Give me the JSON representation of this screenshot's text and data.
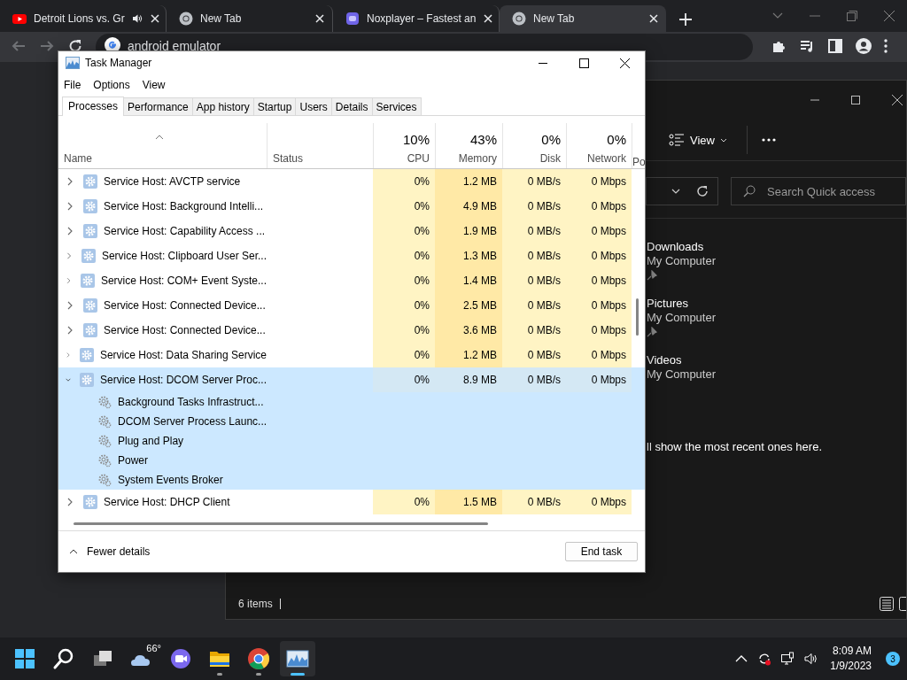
{
  "browser": {
    "tabs": [
      {
        "kind": "youtube",
        "label": "Detroit Lions vs. Gr",
        "audio": true,
        "selected": false
      },
      {
        "kind": "chrome",
        "label": "New Tab",
        "audio": false,
        "selected": false
      },
      {
        "kind": "nox",
        "label": "Noxplayer – Fastest an",
        "audio": false,
        "selected": false
      },
      {
        "kind": "chrome",
        "label": "New Tab",
        "audio": false,
        "selected": true
      }
    ],
    "address": "android emulator"
  },
  "explorer": {
    "view_label": "View",
    "search": {
      "placeholder": "Search Quick access"
    },
    "items": [
      {
        "name": "Downloads",
        "location": "My Computer",
        "pinned": true
      },
      {
        "name": "Pictures",
        "location": "My Computer",
        "pinned": true
      },
      {
        "name": "Videos",
        "location": "My Computer",
        "pinned": false
      }
    ],
    "hint": "ll show the most recent ones here.",
    "status": "6 items"
  },
  "task_manager": {
    "title": "Task Manager",
    "menu": [
      "File",
      "Options",
      "View"
    ],
    "tabs": [
      {
        "label": "Processes",
        "selected": true
      },
      {
        "label": "Performance",
        "selected": false
      },
      {
        "label": "App history",
        "selected": false
      },
      {
        "label": "Startup",
        "selected": false
      },
      {
        "label": "Users",
        "selected": false
      },
      {
        "label": "Details",
        "selected": false
      },
      {
        "label": "Services",
        "selected": false
      }
    ],
    "columns": [
      {
        "name": "Name",
        "sorted": true
      },
      {
        "name": "Status",
        "sorted": false
      },
      {
        "name": "CPU",
        "total": "10%",
        "sorted": false
      },
      {
        "name": "Memory",
        "total": "43%",
        "sorted": false
      },
      {
        "name": "Disk",
        "total": "0%",
        "sorted": false
      },
      {
        "name": "Network",
        "total": "0%",
        "sorted": false
      },
      {
        "name": "Po",
        "sorted": false
      }
    ],
    "rows": [
      {
        "name": "Service Host: AVCTP service",
        "cpu": "0%",
        "memory": "1.2 MB",
        "disk": "0 MB/s",
        "network": "0 Mbps",
        "expanded": false,
        "selected": false
      },
      {
        "name": "Service Host: Background Intelli...",
        "cpu": "0%",
        "memory": "4.9 MB",
        "disk": "0 MB/s",
        "network": "0 Mbps",
        "expanded": false,
        "selected": false
      },
      {
        "name": "Service Host: Capability Access ...",
        "cpu": "0%",
        "memory": "1.9 MB",
        "disk": "0 MB/s",
        "network": "0 Mbps",
        "expanded": false,
        "selected": false
      },
      {
        "name": "Service Host: Clipboard User Ser...",
        "cpu": "0%",
        "memory": "1.3 MB",
        "disk": "0 MB/s",
        "network": "0 Mbps",
        "expanded": false,
        "selected": false
      },
      {
        "name": "Service Host: COM+ Event Syste...",
        "cpu": "0%",
        "memory": "1.4 MB",
        "disk": "0 MB/s",
        "network": "0 Mbps",
        "expanded": false,
        "selected": false
      },
      {
        "name": "Service Host: Connected Device...",
        "cpu": "0%",
        "memory": "2.5 MB",
        "disk": "0 MB/s",
        "network": "0 Mbps",
        "expanded": false,
        "selected": false
      },
      {
        "name": "Service Host: Connected Device...",
        "cpu": "0%",
        "memory": "3.6 MB",
        "disk": "0 MB/s",
        "network": "0 Mbps",
        "expanded": false,
        "selected": false
      },
      {
        "name": "Service Host: Data Sharing Service",
        "cpu": "0%",
        "memory": "1.2 MB",
        "disk": "0 MB/s",
        "network": "0 Mbps",
        "expanded": false,
        "selected": false
      },
      {
        "name": "Service Host: DCOM Server Proc...",
        "cpu": "0%",
        "memory": "8.9 MB",
        "disk": "0 MB/s",
        "network": "0 Mbps",
        "expanded": true,
        "selected": true,
        "children": [
          {
            "name": "Background Tasks Infrastruct..."
          },
          {
            "name": "DCOM Server Process Launc..."
          },
          {
            "name": "Plug and Play"
          },
          {
            "name": "Power"
          },
          {
            "name": "System Events Broker"
          }
        ]
      },
      {
        "name": "Service Host: DHCP Client",
        "cpu": "0%",
        "memory": "1.5 MB",
        "disk": "0 MB/s",
        "network": "0 Mbps",
        "expanded": false,
        "selected": false
      }
    ],
    "footer": {
      "toggle": "Fewer details",
      "button": "End task"
    }
  },
  "taskbar": {
    "apps": [
      {
        "kind": "start",
        "running": false,
        "active": false
      },
      {
        "kind": "search",
        "running": false,
        "active": false
      },
      {
        "kind": "taskview",
        "running": false,
        "active": false
      },
      {
        "kind": "weather",
        "label": "66°",
        "running": false,
        "active": false
      },
      {
        "kind": "chat",
        "running": false,
        "active": false
      },
      {
        "kind": "explorer",
        "running": true,
        "active": false
      },
      {
        "kind": "chrome",
        "running": true,
        "active": false
      },
      {
        "kind": "taskmanager",
        "running": true,
        "active": true
      }
    ],
    "time": "8:09 AM",
    "date": "1/9/2023",
    "notifications": "3"
  }
}
